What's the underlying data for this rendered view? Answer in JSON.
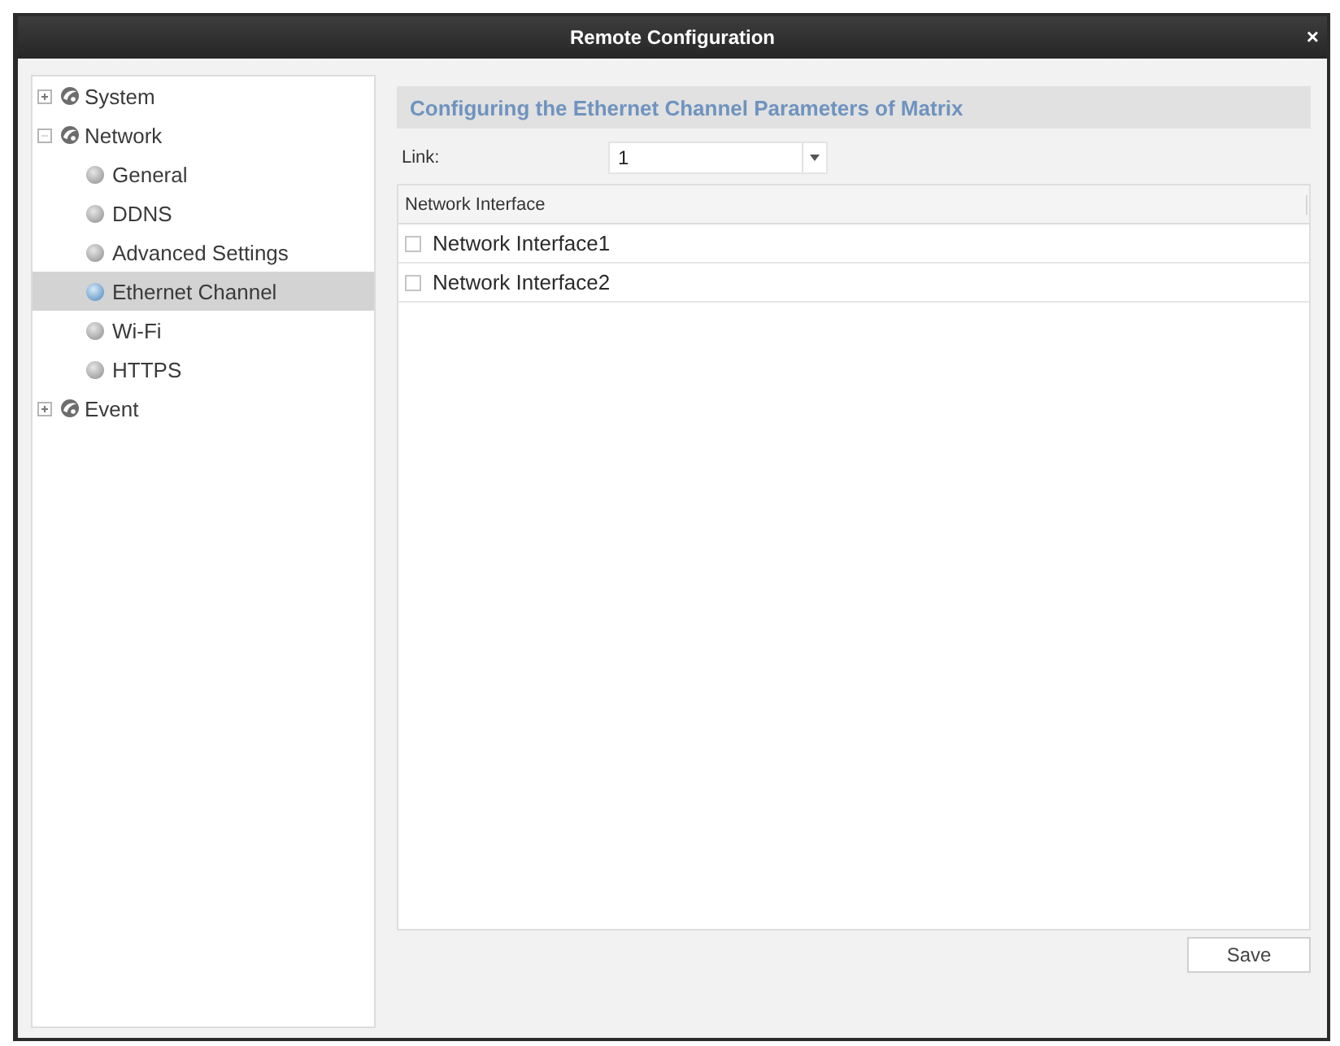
{
  "window": {
    "title": "Remote Configuration",
    "close": "×"
  },
  "tree": [
    {
      "label": "System",
      "expanded": false,
      "selected": false
    },
    {
      "label": "Network",
      "expanded": true,
      "selected": false,
      "children": [
        {
          "label": "General",
          "selected": false
        },
        {
          "label": "DDNS",
          "selected": false
        },
        {
          "label": "Advanced Settings",
          "selected": false
        },
        {
          "label": "Ethernet Channel",
          "selected": true
        },
        {
          "label": "Wi-Fi",
          "selected": false
        },
        {
          "label": "HTTPS",
          "selected": false
        }
      ]
    },
    {
      "label": "Event",
      "expanded": false,
      "selected": false
    }
  ],
  "panel": {
    "heading": "Configuring the Ethernet Channel Parameters of Matrix",
    "link": {
      "label": "Link:",
      "value": "1"
    },
    "table": {
      "columns": [
        "Network Interface"
      ],
      "rows": [
        {
          "label": "Network Interface1",
          "checked": false
        },
        {
          "label": "Network Interface2",
          "checked": false
        }
      ]
    },
    "buttons": [
      "Save"
    ]
  }
}
